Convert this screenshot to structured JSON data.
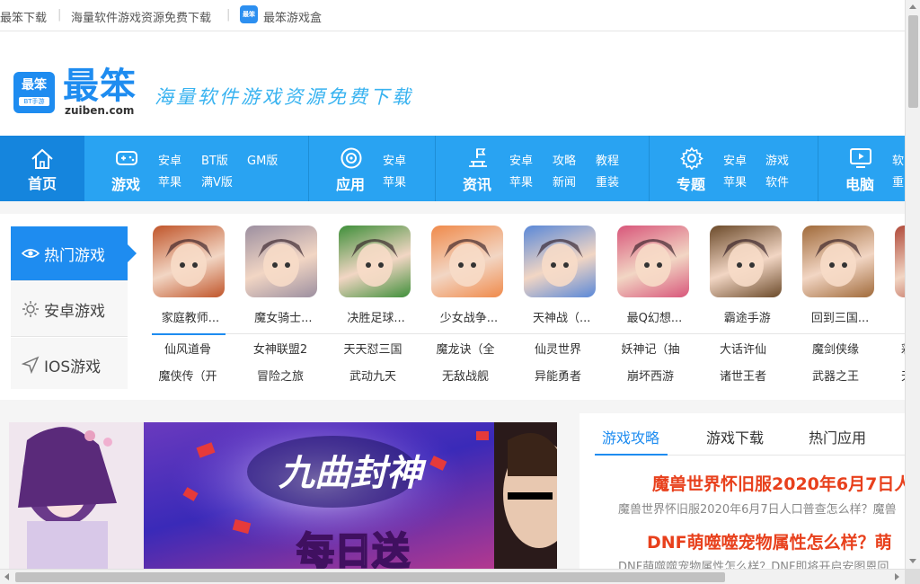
{
  "topbar": {
    "site_name": "最笨下载",
    "slogan": "海量软件游戏资源免费下载",
    "box_icon_text": "最笨",
    "box_link": "最笨游戏盒"
  },
  "header": {
    "logo_icon_text": "最笨",
    "logo_icon_sub": "BT手游",
    "logo_text": "最笨",
    "logo_domain": "zuiben.com",
    "slogan": "海量软件游戏资源免费下载"
  },
  "nav": {
    "home": "首页",
    "game": {
      "label": "游戏",
      "links": [
        "安卓",
        "BT版",
        "GM版",
        "苹果",
        "满V版"
      ]
    },
    "app": {
      "label": "应用",
      "links": [
        "安卓",
        "苹果"
      ]
    },
    "info": {
      "label": "资讯",
      "links": [
        "安卓",
        "攻略",
        "教程",
        "苹果",
        "新闻",
        "重装"
      ]
    },
    "topic": {
      "label": "专题",
      "links": [
        "安卓",
        "游戏",
        "苹果",
        "软件"
      ]
    },
    "pc": {
      "label": "电脑",
      "links": [
        "软",
        "重"
      ]
    }
  },
  "games_panel": {
    "tabs": [
      "热门游戏",
      "安卓游戏",
      "IOS游戏"
    ],
    "items": [
      {
        "name": "家庭教师...",
        "color": "#c0552a"
      },
      {
        "name": "魔女骑士...",
        "color": "#9c8fa0"
      },
      {
        "name": "决胜足球...",
        "color": "#3f8f3a"
      },
      {
        "name": "少女战争...",
        "color": "#f08a4b"
      },
      {
        "name": "天神战（...",
        "color": "#5a88d8"
      },
      {
        "name": "最Q幻想...",
        "color": "#d8567a"
      },
      {
        "name": "霸途手游",
        "color": "#6b4a2a"
      },
      {
        "name": "回到三国...",
        "color": "#a06a3a"
      },
      {
        "name": "幻",
        "color": "#b04a3a"
      }
    ],
    "text_row1": [
      "仙风道骨",
      "女神联盟2",
      "天天怼三国",
      "魔龙诀（全",
      "仙灵世界",
      "妖神记（抽",
      "大话许仙",
      "魔剑侠缘",
      "彩"
    ],
    "text_row2": [
      "魔侠传（开",
      "冒险之旅",
      "武动九天",
      "无敌战舰",
      "异能勇者",
      "崩坏西游",
      "诸世王者",
      "武器之王",
      "天"
    ]
  },
  "banner": {
    "caption": "九曲封神",
    "sub_caption": "每日送"
  },
  "right_panel": {
    "tabs": [
      "游戏攻略",
      "游戏下载",
      "热门应用"
    ],
    "articles": [
      {
        "title": "魔兽世界怀旧服2020年6月7日人",
        "summary": "魔兽世界怀旧服2020年6月7日人口普查怎么样？魔兽"
      },
      {
        "title": "DNF萌噬噬宠物属性怎么样？萌",
        "summary": "DNF萌噬噬宠物属性怎么样？DNF即将开启安图恩回"
      }
    ]
  }
}
